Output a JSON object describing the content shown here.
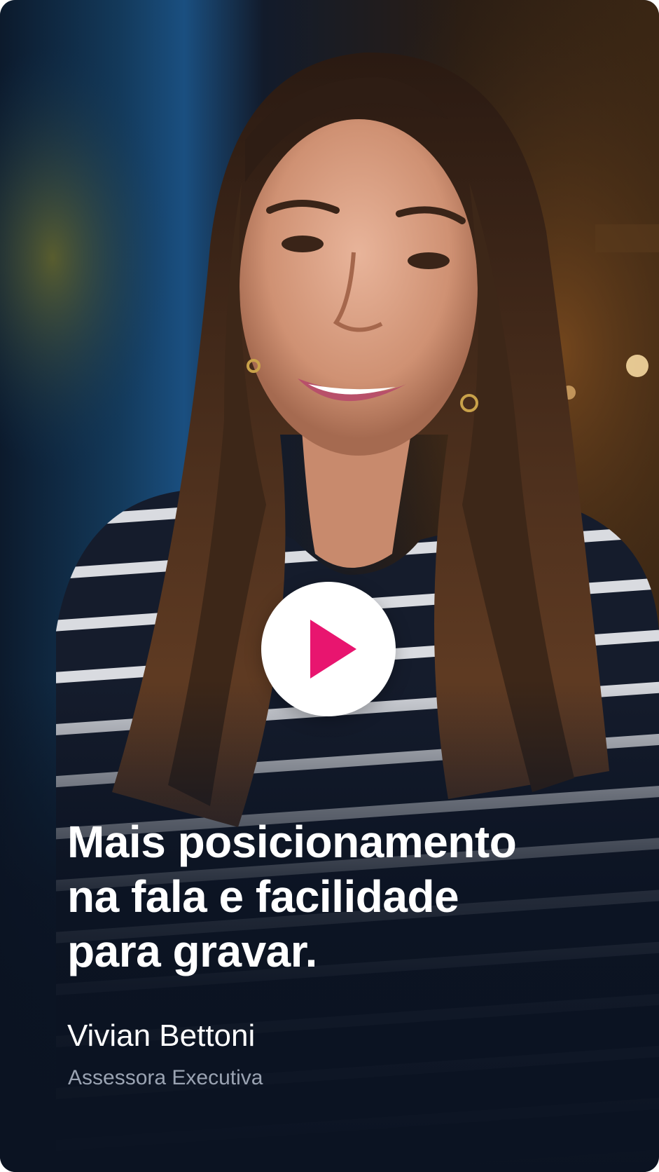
{
  "testimonial": {
    "quote_lines": [
      "Mais posicionamento",
      "na fala e facilidade",
      "para gravar."
    ],
    "person_name": "Vivian Bettoni",
    "person_role": "Assessora Executiva"
  },
  "video": {
    "play_icon": "play-icon"
  },
  "colors": {
    "accent": "#e8156f",
    "background": "#0b1322",
    "role_text": "#9aa3b2"
  }
}
